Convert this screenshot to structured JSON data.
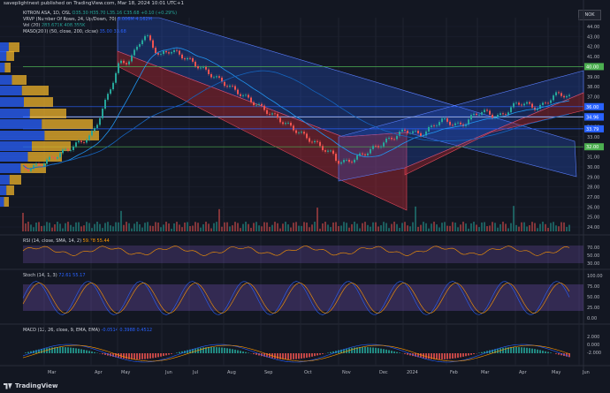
{
  "header": {
    "published_line": "saveplightnest published on TradingView.com, Mar 18, 2024 10:01 UTC+1",
    "currency": "NOK"
  },
  "legends": {
    "symbol": "KITRON ASA, 1D, OSL",
    "ohlc": "O35.30 H35.70 L35.16 C35.68 +0.10 (+0.29%)",
    "vrvp": "VRVP (Number Of Rows, 24, Up/Down, 70)",
    "vrvp_vals": "5.006M 4.162M",
    "vol": "Vol (20)",
    "vol_vals": "283.671K 408.355K",
    "ma": "MASO(200) (50, close, 200, close)",
    "ma_vals": "35.00 33.68",
    "rsi": "RSI (14, close, SMA, 14, 2)",
    "rsi_vals": "59.78 55.44",
    "stoch": "Stoch (14, 1, 3)",
    "stoch_vals": "72.61 55.17",
    "macd": "MACD (12, 26, close, 9, EMA, EMA)",
    "macd_vals": "-0.0514 0.3988 0.4512"
  },
  "price_axis": [
    "44.00",
    "43.00",
    "42.00",
    "41.00",
    "40.00",
    "39.00",
    "38.00",
    "37.00",
    "36.00",
    "35.00",
    "34.00",
    "33.00",
    "32.00",
    "31.00",
    "30.00",
    "29.00",
    "28.00",
    "27.00",
    "26.00",
    "25.00",
    "24.00"
  ],
  "price_tags": [
    {
      "label": "40.00",
      "color": "#4caf50"
    },
    {
      "label": "36.00",
      "color": "#2962ff"
    },
    {
      "label": "35.00",
      "color": "#2962ff"
    },
    {
      "label": "34.96",
      "color": "#2962ff"
    },
    {
      "label": "33.79",
      "color": "#2962ff"
    },
    {
      "label": "32.00",
      "color": "#4caf50"
    }
  ],
  "rsi_axis": [
    "70.00",
    "50.00",
    "30.00"
  ],
  "stoch_axis": [
    "100.00",
    "75.00",
    "50.00",
    "25.00",
    "0.00"
  ],
  "macd_axis": [
    "2.000",
    "0.000",
    "-2.000"
  ],
  "x_axis": [
    "Mar",
    "Apr",
    "May",
    "Jun",
    "Jul",
    "Aug",
    "Sep",
    "Oct",
    "Nov",
    "Dec",
    "2024",
    "Feb",
    "Mar",
    "Apr",
    "May",
    "Jun"
  ],
  "branding": "TradingView"
}
